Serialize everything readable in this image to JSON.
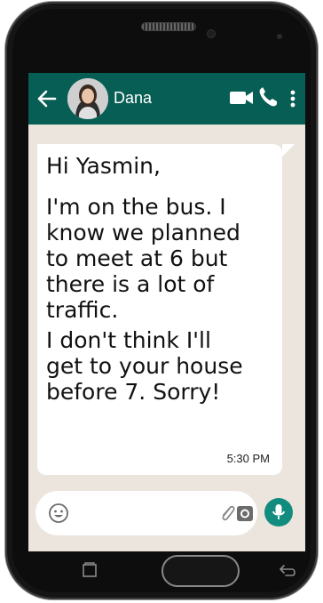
{
  "header": {
    "contact_name": "Dana",
    "icons": [
      "back-arrow-icon",
      "contact-avatar",
      "video-call-icon",
      "phone-call-icon",
      "more-options-icon"
    ]
  },
  "message": {
    "greeting": "Hi Yasmin,",
    "paragraph_1": "I'm on the bus. I\nknow we planned\nto meet at 6 but\nthere is a lot of\ntraffic.",
    "paragraph_2": "I don't think I'll\nget to your house\nbefore 7. Sorry!",
    "time": "5:30 PM"
  },
  "composer": {
    "icons": [
      "emoji-icon",
      "paperclip-icon",
      "camera-icon",
      "mic-icon"
    ]
  },
  "colors": {
    "header_bg": "#075e54",
    "chat_bg": "#ece5dd",
    "bubble_bg": "#ffffff",
    "mic_bg": "#128c7e"
  }
}
